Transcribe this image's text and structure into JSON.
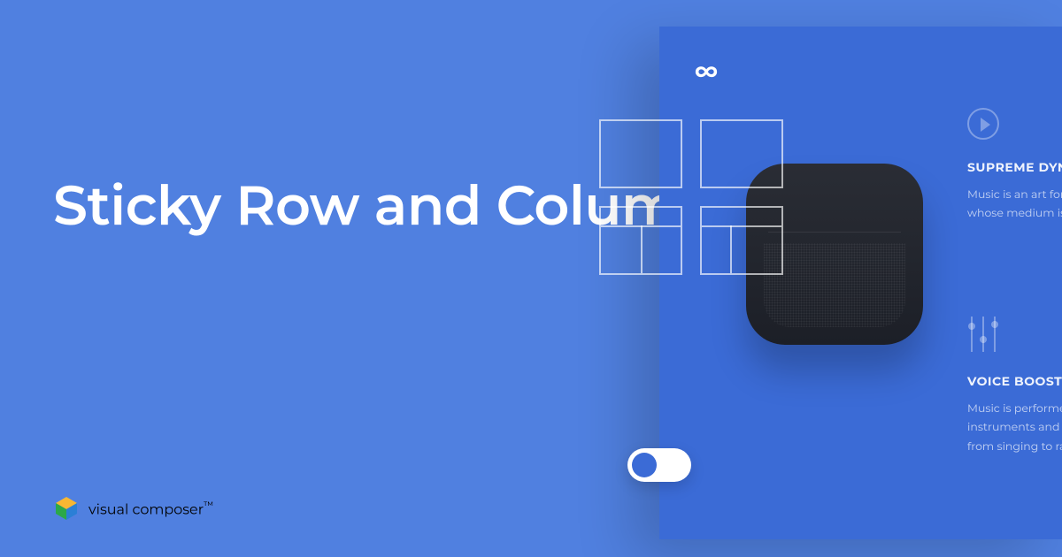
{
  "title": "Sticky Row and Column",
  "brand": "visual composer",
  "tm": "™",
  "infinity": "∞",
  "features": {
    "f1": {
      "heading": "SUPREME DYN",
      "line1": "Music is an art form a",
      "line2": "whose medium is sou"
    },
    "f2": {
      "heading": "VOICE BOOST",
      "line1": "Music is performed w",
      "line2": "instruments and voca",
      "line3": "from singing to rappi"
    }
  }
}
